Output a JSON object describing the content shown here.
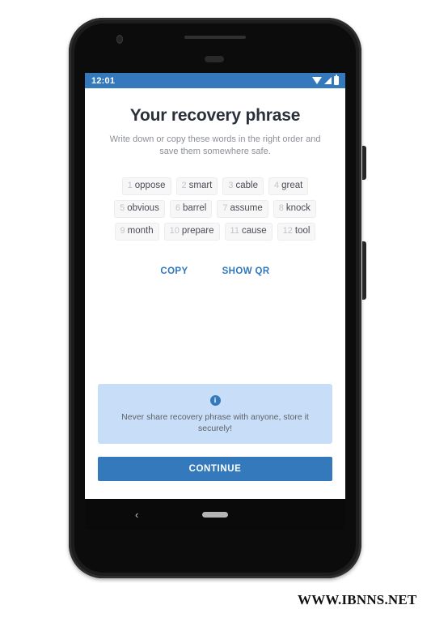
{
  "device": {
    "frame_color": "#1c1c1c",
    "screen_bg": "#ffffff"
  },
  "status_bar": {
    "time": "12:01",
    "background": "#3579bd",
    "icons": [
      "wifi-icon",
      "signal-icon",
      "battery-icon"
    ]
  },
  "screen": {
    "title": "Your recovery phrase",
    "subtitle": "Write down or copy these words in the right order and save them somewhere safe.",
    "recovery_phrase": [
      {
        "index": "1",
        "word": "oppose"
      },
      {
        "index": "2",
        "word": "smart"
      },
      {
        "index": "3",
        "word": "cable"
      },
      {
        "index": "4",
        "word": "great"
      },
      {
        "index": "5",
        "word": "obvious"
      },
      {
        "index": "6",
        "word": "barrel"
      },
      {
        "index": "7",
        "word": "assume"
      },
      {
        "index": "8",
        "word": "knock"
      },
      {
        "index": "9",
        "word": "month"
      },
      {
        "index": "10",
        "word": "prepare"
      },
      {
        "index": "11",
        "word": "cause"
      },
      {
        "index": "12",
        "word": "tool"
      }
    ],
    "actions": {
      "copy_label": "COPY",
      "show_qr_label": "SHOW QR",
      "link_color": "#2f77bd"
    },
    "notice": {
      "icon": "info-icon",
      "icon_glyph": "i",
      "text": "Never share recovery phrase with anyone, store it securely!",
      "background": "#c8def8"
    },
    "continue_label": "CONTINUE",
    "continue_color": "#3579bd"
  },
  "nav_bar": {
    "back_glyph": "‹",
    "home_indicator": "home-pill"
  },
  "watermark": {
    "text": "WWW.IBNNS.NET"
  }
}
